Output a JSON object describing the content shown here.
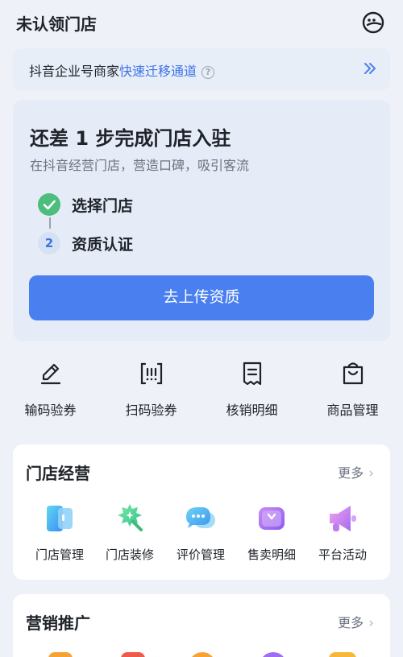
{
  "header": {
    "title": "未认领门店",
    "icon": "face-icon"
  },
  "migrate_banner": {
    "text": "抖音企业号商家",
    "link": "快速迁移通道",
    "help": "?"
  },
  "onboarding": {
    "title": "还差 1 步完成门店入驻",
    "subtitle": "在抖音经营门店，营造口碑，吸引客流",
    "steps": [
      {
        "label": "选择门店",
        "status": "done"
      },
      {
        "label": "资质认证",
        "number": "2",
        "status": "pending"
      }
    ],
    "button": "去上传资质"
  },
  "tools": [
    {
      "label": "输码验券",
      "icon": "pencil-icon"
    },
    {
      "label": "扫码验券",
      "icon": "scan-icon"
    },
    {
      "label": "核销明细",
      "icon": "receipt-icon"
    },
    {
      "label": "商品管理",
      "icon": "shopping-bag-icon"
    }
  ],
  "store_ops": {
    "title": "门店经营",
    "more": "更多",
    "items": [
      {
        "label": "门店管理",
        "icon": "store-manage-icon"
      },
      {
        "label": "门店装修",
        "icon": "store-decor-icon"
      },
      {
        "label": "评价管理",
        "icon": "review-icon"
      },
      {
        "label": "售卖明细",
        "icon": "sales-detail-icon"
      },
      {
        "label": "平台活动",
        "icon": "platform-activity-icon"
      }
    ]
  },
  "marketing": {
    "title": "营销推广",
    "more": "更多"
  },
  "colors": {
    "primary": "#4a7ff0",
    "link": "#3d72e8",
    "success": "#4bbd7c"
  }
}
